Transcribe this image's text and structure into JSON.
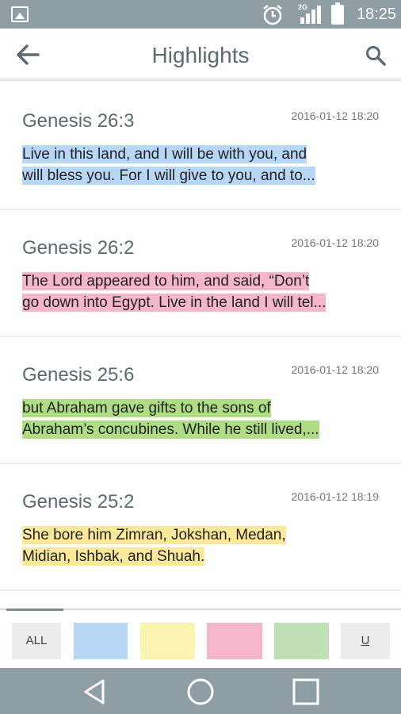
{
  "status_bar": {
    "network": "2G",
    "time": "18:25"
  },
  "app_bar": {
    "title": "Highlights",
    "icons": [
      "back-arrow-icon",
      "search-icon"
    ]
  },
  "highlights": [
    {
      "reference": "Genesis 26:3",
      "date": "2016-01-12 18:20",
      "line1": "Live in this land, and I will be with you, and",
      "line2": "will bless you. For I will give to you, and to...",
      "color": "#b8d6f5"
    },
    {
      "reference": "Genesis 26:2",
      "date": "2016-01-12 18:20",
      "line1": "The Lord appeared to him, and said, “Don’t",
      "line2": "go down into Egypt. Live in the land I will tel...",
      "color": "#f5b6c9"
    },
    {
      "reference": "Genesis 25:6",
      "date": "2016-01-12 18:20",
      "line1": "but Abraham gave gifts to the sons of",
      "line2": "Abraham’s concubines. While he still lived,...",
      "color": "#aedd85"
    },
    {
      "reference": "Genesis 25:2",
      "date": "2016-01-12 18:19",
      "line1": "She bore him Zimran, Jokshan, Medan,",
      "line2": "Midian, Ishbak, and Shuah.",
      "color": "#fbe89a"
    }
  ],
  "filter_bar": {
    "all_label": "ALL",
    "u_label": "U",
    "colors": [
      "#b8d6f5",
      "#fbf3b0",
      "#f5b6c9",
      "#bfe0b4"
    ]
  },
  "nav_bar": {
    "icons": [
      "back-triangle-icon",
      "home-circle-icon",
      "recents-square-icon"
    ]
  }
}
